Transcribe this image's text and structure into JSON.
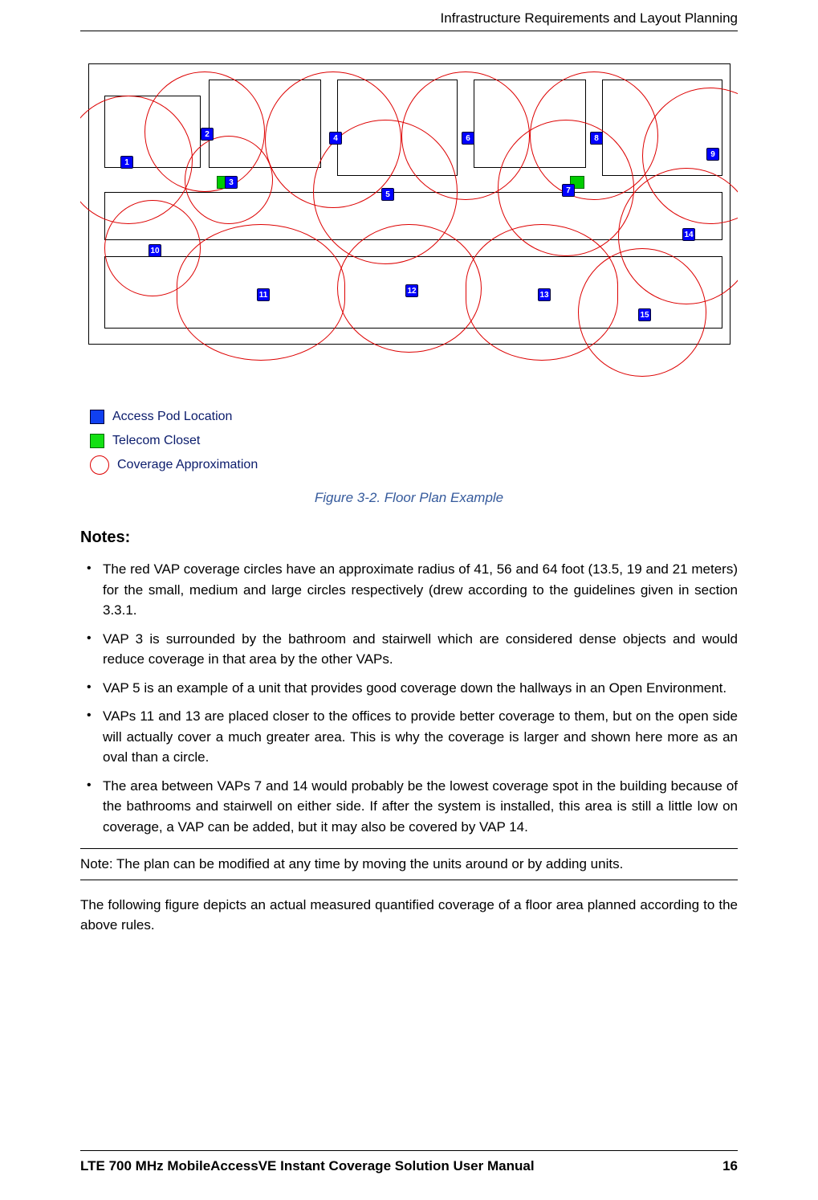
{
  "header_title": "Infrastructure Requirements and Layout Planning",
  "legend": {
    "access_pod": "Access Pod Location",
    "telecom": "Telecom Closet",
    "coverage": "Coverage Approximation"
  },
  "figure_caption": "Figure 3-2. Floor Plan Example",
  "notes_heading": "Notes:",
  "notes": [
    "The red VAP coverage circles have an approximate radius of 41, 56 and 64 foot (13.5, 19 and 21 meters) for the small, medium and large circles respectively (drew according to the guidelines given in section 3.3.1.",
    "VAP 3 is surrounded by the bathroom and stairwell which are considered dense objects and would reduce coverage in that area by the other VAPs.",
    "VAP 5 is an example of a unit that provides good coverage down the hallways in an Open Environment.",
    "VAPs 11 and 13 are placed closer to the offices to provide better coverage to them, but on the open side will actually cover a much greater area.  This is why the coverage is larger and shown here more as an oval than a circle.",
    "The area between VAPs 7 and 14 would probably be the lowest coverage spot in the building because of the bathrooms and stairwell on either side. If after the system is installed, this area is still a little low on coverage, a VAP can be added, but it may also be covered by VAP 14."
  ],
  "boxed_note": "Note: The plan can be modified at any time by moving the units around or by adding units.",
  "following_para": "The following figure depicts an actual measured quantified coverage of a floor area planned according to the above rules.",
  "footer_title": "LTE 700 MHz MobileAccessVE Instant Coverage Solution User Manual",
  "page_number": "16",
  "floor_plan": {
    "vaps": [
      "1",
      "2",
      "3",
      "4",
      "5",
      "6",
      "7",
      "8",
      "9",
      "10",
      "11",
      "12",
      "13",
      "14",
      "15"
    ]
  }
}
